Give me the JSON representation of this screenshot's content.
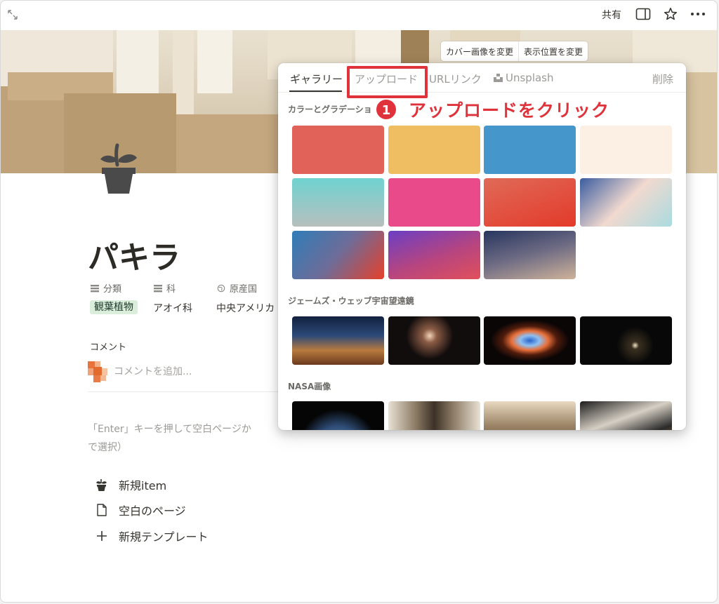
{
  "topbar": {
    "share_label": "共有",
    "icons": [
      "expand-icon",
      "sidebar-icon",
      "star-icon",
      "more-icon"
    ]
  },
  "cover": {
    "change_cover": "カバー画像を変更",
    "reposition": "表示位置を変更"
  },
  "page": {
    "title": "パキラ",
    "icon": "plant-pot-icon"
  },
  "properties": [
    {
      "name": "分類",
      "value": "観葉植物",
      "icon": "list-icon"
    },
    {
      "name": "科",
      "value": "アオイ科",
      "icon": "list-icon"
    },
    {
      "name": "原産国",
      "value": "中央アメリカ",
      "icon": "globe-icon"
    }
  ],
  "comments": {
    "label": "コメント",
    "placeholder": "コメントを追加..."
  },
  "enter_hint": {
    "line1": "「Enter」キーを押して空白ページか",
    "line2": "で選択）"
  },
  "templates": [
    {
      "label": "新規item",
      "icon": "plant-pot-icon"
    },
    {
      "label": "空白のページ",
      "icon": "page-icon"
    },
    {
      "label": "新規テンプレート",
      "icon": "plus-icon"
    }
  ],
  "popover": {
    "tabs": [
      {
        "label": "ギャラリー",
        "active": true
      },
      {
        "label": "アップロード",
        "active": false
      },
      {
        "label": "URLリンク",
        "active": false
      },
      {
        "label": "Unsplash",
        "active": false
      }
    ],
    "remove_label": "削除",
    "sections": {
      "colors": "カラーとグラデーショ",
      "jwst": "ジェームズ・ウェッブ宇宙望遠鏡",
      "nasa": "NASA画像"
    },
    "annotation": {
      "number": "1",
      "text": "アップロードをクリック",
      "color": "#e0323a"
    },
    "colors": [
      "#e06259",
      "#f0be62",
      "#4596cb",
      "#fbf0e3"
    ]
  }
}
